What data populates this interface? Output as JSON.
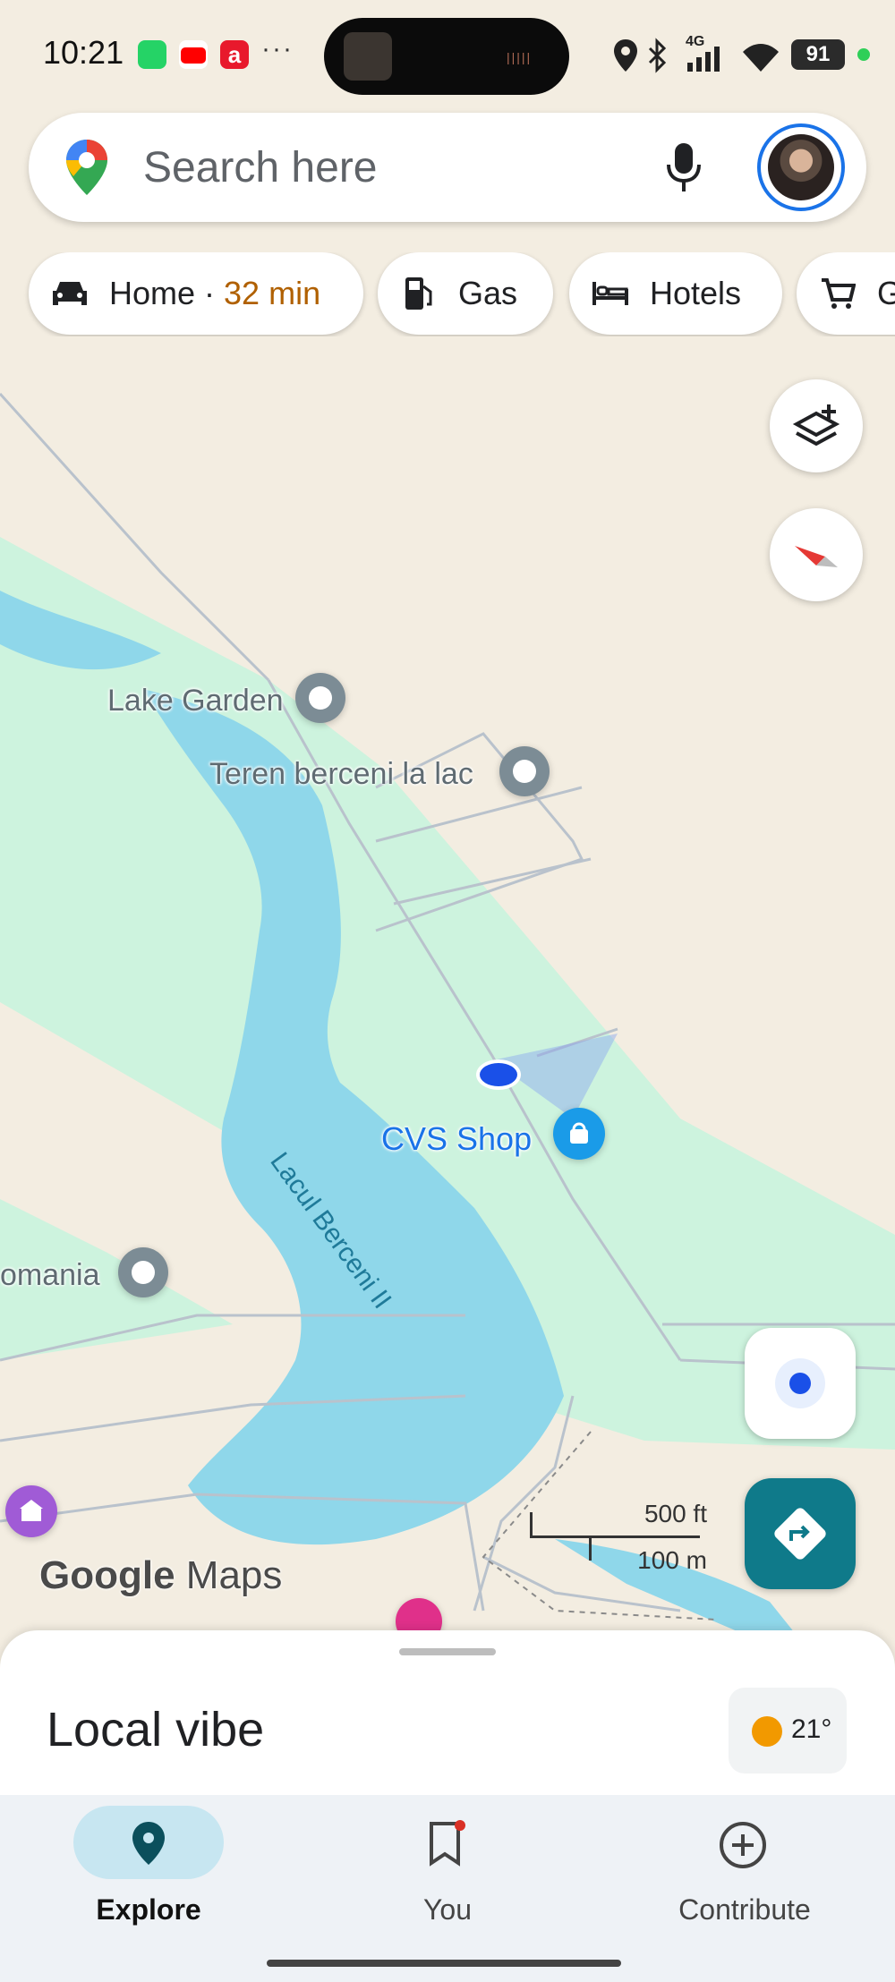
{
  "status_bar": {
    "time": "10:21",
    "more": "···",
    "battery": "91",
    "network": "4G",
    "icons": [
      "whatsapp-icon",
      "youtube-icon",
      "a-app-icon",
      "location-icon",
      "bluetooth-icon",
      "signal-icon",
      "wifi-icon"
    ]
  },
  "search": {
    "placeholder": "Search here",
    "icons": [
      "google-maps-pin-icon",
      "mic-icon",
      "avatar"
    ]
  },
  "chips": [
    {
      "label": "Home",
      "separator": " · ",
      "eta": "32 min",
      "icon": "car-icon"
    },
    {
      "label": "Gas",
      "icon": "gas-station-icon"
    },
    {
      "label": "Hotels",
      "icon": "bed-icon"
    },
    {
      "label": "G",
      "icon": "cart-icon"
    }
  ],
  "map": {
    "places": [
      {
        "name": "Lake Garden"
      },
      {
        "name": "Teren berceni la lac"
      },
      {
        "name": "CVS Shop"
      },
      {
        "name": "omania"
      }
    ],
    "water_label": "Lacul Berceni II",
    "scale": {
      "imperial": "500 ft",
      "metric": "100 m"
    },
    "brand": {
      "part1": "Google",
      "part2": " Maps"
    }
  },
  "sheet": {
    "title": "Local vibe",
    "weather": {
      "temp": "21°"
    }
  },
  "nav": {
    "tabs": [
      {
        "label": "Explore",
        "active": true
      },
      {
        "label": "You",
        "active": false
      },
      {
        "label": "Contribute",
        "active": false
      }
    ]
  },
  "colors": {
    "accent": "#1a73e8",
    "water": "#8fd7ea",
    "park": "#cdf3de",
    "land": "#f3ede1",
    "fab": "#0f7a8a",
    "eta": "#b06000"
  }
}
